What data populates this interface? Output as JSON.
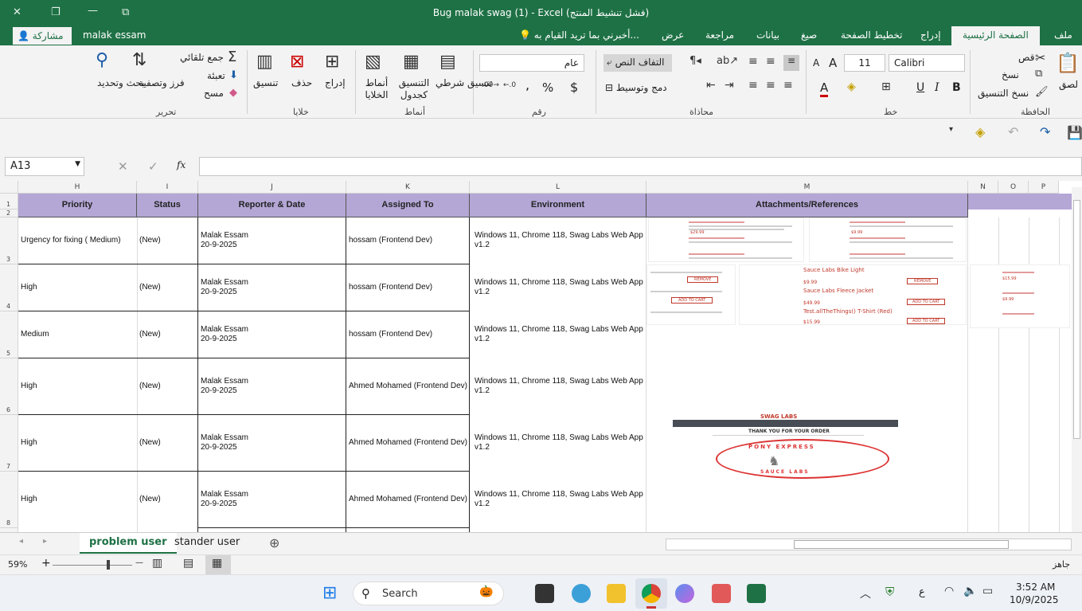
{
  "window": {
    "title": "Bug malak swag (1) - Excel (فشل تنشيط المنتج)",
    "minimize": "—",
    "restore": "❐",
    "close": "✕",
    "restore2": "⧉"
  },
  "tabs": {
    "file": "ملف",
    "home": "الصفحة الرئيسية",
    "insert": "إدراج",
    "layout": "تخطيط الصفحة",
    "formulas": "صيغ",
    "data": "بيانات",
    "review": "مراجعة",
    "view": "عرض",
    "tellme": "أخبرني بما تريد القيام به...",
    "user": "malak essam",
    "share": "مشاركة"
  },
  "ribbon": {
    "clipboard": {
      "label": "الحافظة",
      "paste": "لصق",
      "cut": "قص",
      "copy": "نسخ",
      "format_painter": "نسخ التنسيق"
    },
    "font": {
      "label": "خط",
      "name": "Calibri",
      "size": "11",
      "bold": "B",
      "italic": "I",
      "underline": "U"
    },
    "alignment": {
      "label": "محاذاة",
      "wrap": "التفاف النص",
      "merge": "دمج وتوسيط"
    },
    "number": {
      "label": "رقم",
      "format": "عام",
      "currency": "$",
      "percent": "%",
      "comma": ","
    },
    "styles": {
      "label": "أنماط",
      "conditional": "تنسيق شرطي",
      "table": "التنسيق كجدول",
      "cell_styles": "أنماط الخلايا"
    },
    "cells": {
      "label": "خلايا",
      "insert": "إدراج",
      "delete": "حذف",
      "format": "تنسيق"
    },
    "editing": {
      "label": "تحرير",
      "autosum": "جمع تلقائي",
      "fill": "تعبئة",
      "clear": "مسح",
      "sort": "فرز وتصفية",
      "find": "بحث وتحديد"
    }
  },
  "formula_bar": {
    "name_box": "A13",
    "fx": "fx",
    "cancel": "✕",
    "enter": "✓",
    "value": ""
  },
  "columns": {
    "H": "H",
    "I": "I",
    "J": "J",
    "K": "K",
    "L": "L",
    "M": "M",
    "N": "N",
    "O": "O",
    "P": "P"
  },
  "headers": {
    "priority": "Priority",
    "status": "Status",
    "reporter": "Reporter & Date",
    "assigned": "Assigned To",
    "environment": "Environment",
    "attachments": "Attachments/References"
  },
  "rows": [
    {
      "num": "3",
      "priority": "Urgency for fixing ( Medium)",
      "status": "(New)",
      "reporter": "Malak Essam\n20-9-2025",
      "assigned": "hossam (Frontend Dev)",
      "environment": "Windows 11, Chrome 118, Swag Labs Web App v1.2"
    },
    {
      "num": "4",
      "priority": "High",
      "status": "(New)",
      "reporter": "Malak Essam\n20-9-2025",
      "assigned": "hossam (Frontend Dev)",
      "environment": "Windows 11, Chrome 118, Swag Labs Web App v1.2"
    },
    {
      "num": "5",
      "priority": "Medium",
      "status": "(New)",
      "reporter": "Malak Essam\n20-9-2025",
      "assigned": "hossam (Frontend Dev)",
      "environment": "Windows 11, Chrome 118, Swag Labs Web App v1.2"
    },
    {
      "num": "6",
      "priority": "High",
      "status": "(New)",
      "reporter": "Malak Essam\n20-9-2025",
      "assigned": "Ahmed Mohamed (Frontend Dev)",
      "environment": "Windows 11, Chrome 118, Swag Labs Web App v1.2"
    },
    {
      "num": "7",
      "priority": "High",
      "status": "(New)",
      "reporter": "Malak Essam\n20-9-2025",
      "assigned": "Ahmed Mohamed (Frontend Dev)",
      "environment": "Windows 11, Chrome 118, Swag Labs Web App v1.2"
    },
    {
      "num": "8",
      "priority": "High",
      "status": "(New)",
      "reporter": "Malak Essam\n20-9-2025",
      "assigned": "Ahmed Mohamed (Frontend Dev)",
      "environment": "Windows 11, Chrome 118, Swag Labs Web App v1.2"
    }
  ],
  "row_labels": {
    "r1": "1",
    "r2": "2"
  },
  "attachments": {
    "brand": "SWAG LABS",
    "thanks": "THANK YOU FOR YOUR ORDER",
    "pony1": "PONY EXPRESS",
    "pony2": "SAUCE LABS",
    "remove": "REMOVE",
    "add": "ADD TO CART",
    "p1": "$29.99",
    "p2": "$9.99",
    "p3": "$15.99",
    "p4": "$49.99",
    "p5": "$15.99",
    "fleece": "Sauce Labs Fleece Jacket",
    "bike": "Sauce Labs Bike Light",
    "tshirt": "Test.allTheThings() T-Shirt (Red)"
  },
  "sheets": {
    "problem": "problem user",
    "standard": "stander user",
    "add": "⊕"
  },
  "status": {
    "ready": "جاهز",
    "zoom": "59%",
    "minus": "—",
    "plus": "+"
  },
  "taskbar": {
    "search": "Search",
    "time": "3:52 AM",
    "date": "10/9/2025",
    "lang": "ع"
  }
}
